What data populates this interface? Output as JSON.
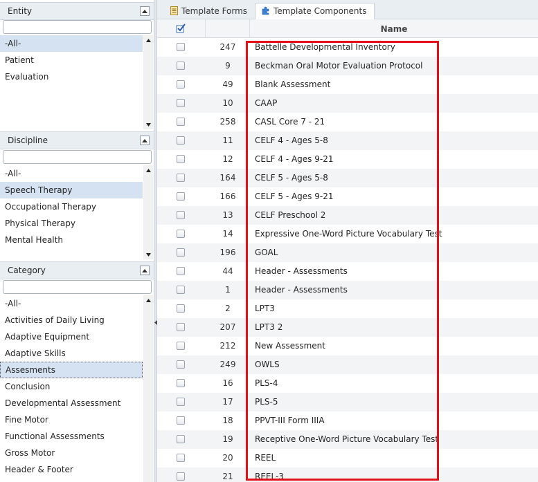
{
  "entity": {
    "title": "Entity",
    "filter_placeholder": "",
    "items": [
      "-All-",
      "Patient",
      "Evaluation"
    ],
    "selected": "-All-"
  },
  "discipline": {
    "title": "Discipline",
    "filter_placeholder": "",
    "items": [
      "-All-",
      "Speech Therapy",
      "Occupational Therapy",
      "Physical Therapy",
      "Mental Health"
    ],
    "selected": "Speech Therapy"
  },
  "category": {
    "title": "Category",
    "filter_placeholder": "",
    "items": [
      "-All-",
      "Activities of Daily Living",
      "Adaptive Equipment",
      "Adaptive Skills",
      "Assesments",
      "Conclusion",
      "Developmental Assessment",
      "Fine Motor",
      "Functional Assessments",
      "Gross Motor",
      "Header & Footer"
    ],
    "selected": "Assesments"
  },
  "tabs": [
    {
      "label": "Template Forms",
      "icon": "form-icon",
      "active": false
    },
    {
      "label": "Template Components",
      "icon": "puzzle-icon",
      "active": true
    }
  ],
  "grid": {
    "header_select_icon": "check-all-icon",
    "name_header": "Name",
    "rows": [
      {
        "id": "247",
        "name": "Battelle Developmental Inventory"
      },
      {
        "id": "9",
        "name": "Beckman Oral Motor Evaluation Protocol"
      },
      {
        "id": "49",
        "name": "Blank Assessment"
      },
      {
        "id": "10",
        "name": "CAAP"
      },
      {
        "id": "258",
        "name": "CASL Core 7 - 21"
      },
      {
        "id": "11",
        "name": "CELF 4 - Ages 5-8"
      },
      {
        "id": "12",
        "name": "CELF 4 - Ages 9-21"
      },
      {
        "id": "164",
        "name": "CELF 5 - Ages 5-8"
      },
      {
        "id": "166",
        "name": "CELF 5 - Ages 9-21"
      },
      {
        "id": "13",
        "name": "CELF Preschool 2"
      },
      {
        "id": "14",
        "name": "Expressive One-Word Picture Vocabulary Test"
      },
      {
        "id": "196",
        "name": "GOAL"
      },
      {
        "id": "44",
        "name": "Header - Assessments"
      },
      {
        "id": "1",
        "name": "Header - Assessments"
      },
      {
        "id": "2",
        "name": "LPT3"
      },
      {
        "id": "207",
        "name": "LPT3 2"
      },
      {
        "id": "212",
        "name": "New Assessment"
      },
      {
        "id": "249",
        "name": "OWLS"
      },
      {
        "id": "16",
        "name": "PLS-4"
      },
      {
        "id": "17",
        "name": "PLS-5"
      },
      {
        "id": "18",
        "name": "PPVT-III Form IIIA"
      },
      {
        "id": "19",
        "name": "Receptive One-Word Picture Vocabulary Test"
      },
      {
        "id": "20",
        "name": "REEL"
      },
      {
        "id": "21",
        "name": "REEL-3"
      }
    ]
  },
  "colors": {
    "highlight": "#e3101a",
    "selected_row": "#d5e2f2",
    "header_bg": "#e9eef3"
  }
}
